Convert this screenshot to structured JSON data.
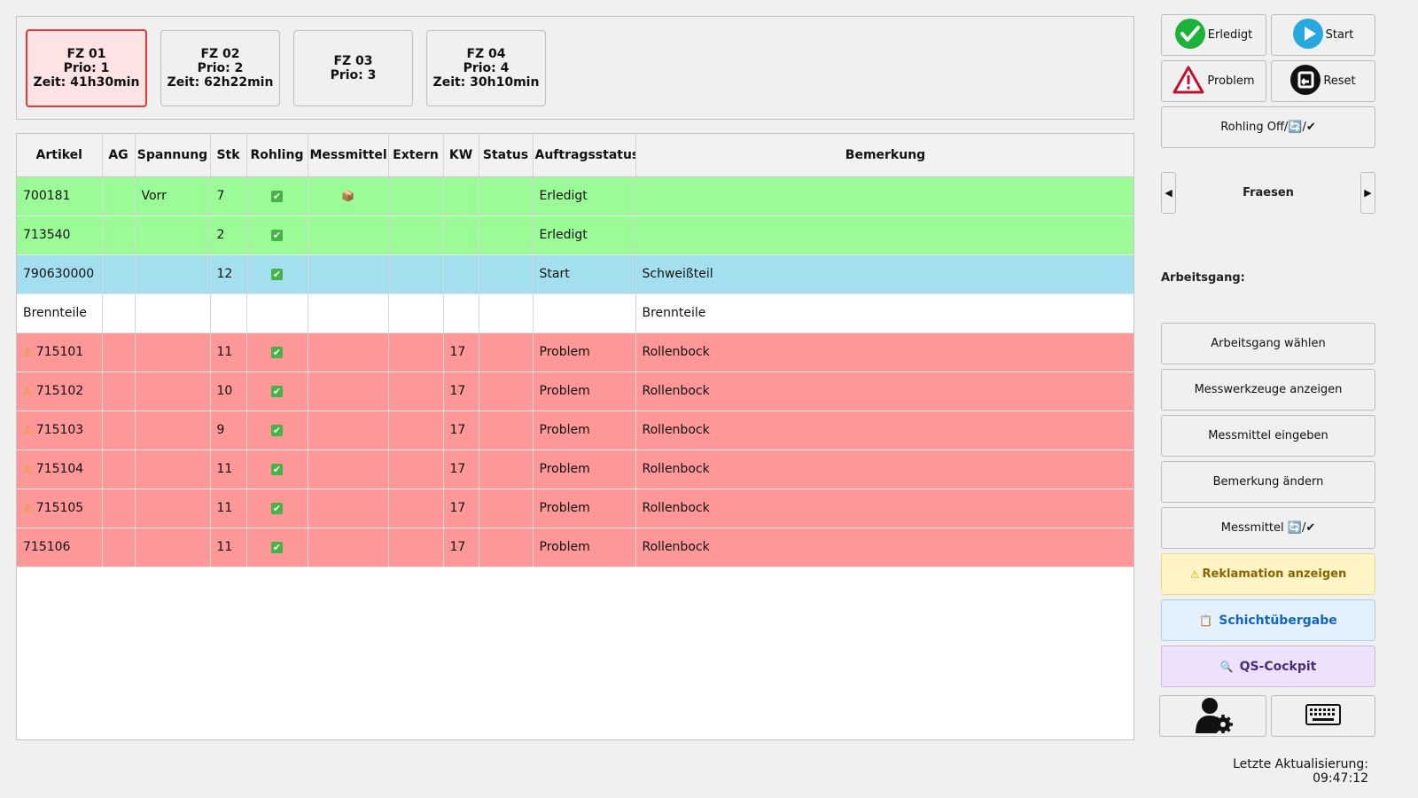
{
  "vehicles": [
    {
      "name": "FZ 01",
      "prio": "Prio: 1",
      "time": "Zeit: 41h30min",
      "active": true
    },
    {
      "name": "FZ 02",
      "prio": "Prio: 2",
      "time": "Zeit: 62h22min",
      "active": false
    },
    {
      "name": "FZ 03",
      "prio": "Prio: 3",
      "time": "",
      "active": false
    },
    {
      "name": "FZ 04",
      "prio": "Prio: 4",
      "time": "Zeit: 30h10min",
      "active": false
    }
  ],
  "table": {
    "columns": [
      "Artikel",
      "AG",
      "Spannung",
      "Stk",
      "Rohling",
      "Messmittel",
      "Extern",
      "KW",
      "Status",
      "Auftragsstatus",
      "Bemerkung"
    ],
    "rows": [
      {
        "state": "green",
        "warn": false,
        "artikel": "700181",
        "ag": "",
        "spannung": "Vorr",
        "stk": "7",
        "rohling": "✔",
        "messmittel": "📦",
        "extern": "",
        "kw": "",
        "status": "",
        "auftragsstatus": "Erledigt",
        "bemerkung": ""
      },
      {
        "state": "green",
        "warn": false,
        "artikel": "713540",
        "ag": "",
        "spannung": "",
        "stk": "2",
        "rohling": "✔",
        "messmittel": "",
        "extern": "",
        "kw": "",
        "status": "",
        "auftragsstatus": "Erledigt",
        "bemerkung": ""
      },
      {
        "state": "blue",
        "warn": false,
        "artikel": "790630000",
        "ag": "",
        "spannung": "",
        "stk": "12",
        "rohling": "✔",
        "messmittel": "",
        "extern": "",
        "kw": "",
        "status": "",
        "auftragsstatus": "Start",
        "bemerkung": "Schweißteil"
      },
      {
        "state": "white",
        "warn": false,
        "artikel": "Brennteile",
        "ag": "",
        "spannung": "",
        "stk": "",
        "rohling": "",
        "messmittel": "",
        "extern": "",
        "kw": "",
        "status": "",
        "auftragsstatus": "",
        "bemerkung": "Brennteile"
      },
      {
        "state": "red",
        "warn": true,
        "artikel": "715101",
        "ag": "",
        "spannung": "",
        "stk": "11",
        "rohling": "✔",
        "messmittel": "",
        "extern": "",
        "kw": "17",
        "status": "",
        "auftragsstatus": "Problem",
        "bemerkung": "Rollenbock"
      },
      {
        "state": "red",
        "warn": true,
        "artikel": "715102",
        "ag": "",
        "spannung": "",
        "stk": "10",
        "rohling": "✔",
        "messmittel": "",
        "extern": "",
        "kw": "17",
        "status": "",
        "auftragsstatus": "Problem",
        "bemerkung": "Rollenbock"
      },
      {
        "state": "red",
        "warn": true,
        "artikel": "715103",
        "ag": "",
        "spannung": "",
        "stk": "9",
        "rohling": "✔",
        "messmittel": "",
        "extern": "",
        "kw": "17",
        "status": "",
        "auftragsstatus": "Problem",
        "bemerkung": "Rollenbock"
      },
      {
        "state": "red",
        "warn": true,
        "artikel": "715104",
        "ag": "",
        "spannung": "",
        "stk": "11",
        "rohling": "✔",
        "messmittel": "",
        "extern": "",
        "kw": "17",
        "status": "",
        "auftragsstatus": "Problem",
        "bemerkung": "Rollenbock"
      },
      {
        "state": "red",
        "warn": true,
        "artikel": "715105",
        "ag": "",
        "spannung": "",
        "stk": "11",
        "rohling": "✔",
        "messmittel": "",
        "extern": "",
        "kw": "17",
        "status": "",
        "auftragsstatus": "Problem",
        "bemerkung": "Rollenbock"
      },
      {
        "state": "red",
        "warn": false,
        "artikel": "715106",
        "ag": "",
        "spannung": "",
        "stk": "11",
        "rohling": "✔",
        "messmittel": "",
        "extern": "",
        "kw": "17",
        "status": "",
        "auftragsstatus": "Problem",
        "bemerkung": "Rollenbock"
      }
    ]
  },
  "actions": {
    "erledigt": "Erledigt",
    "start": "Start",
    "problem": "Problem",
    "reset": "Reset",
    "rohling": "Rohling Off/🔄/✔",
    "section_prev": "◀",
    "section_name": "Fraesen",
    "section_next": "▶",
    "arbeitsgang_label": "Arbeitsgang:",
    "arbeitsgang_waehlen": "Arbeitsgang wählen",
    "messwerkzeuge": "Messwerkzeuge anzeigen",
    "messmittel_eingeben": "Messmittel eingeben",
    "bemerkung_aendern": "Bemerkung ändern",
    "messmittel_toggle": "Messmittel 🔄/✔",
    "reklamation": "Reklamation anzeigen",
    "schicht": "Schichtübergabe",
    "qs": "QS-Cockpit"
  },
  "colors": {
    "done": "#9afb97",
    "started": "#a4dff0",
    "problem": "#fe9797",
    "active_card": "#e53935",
    "reklamation_bg": "#fff4c6",
    "schicht_bg": "#e3f1fd",
    "qs_bg": "#ede1fb"
  },
  "status_bar": "Letzte Aktualisierung: 09:47:12"
}
